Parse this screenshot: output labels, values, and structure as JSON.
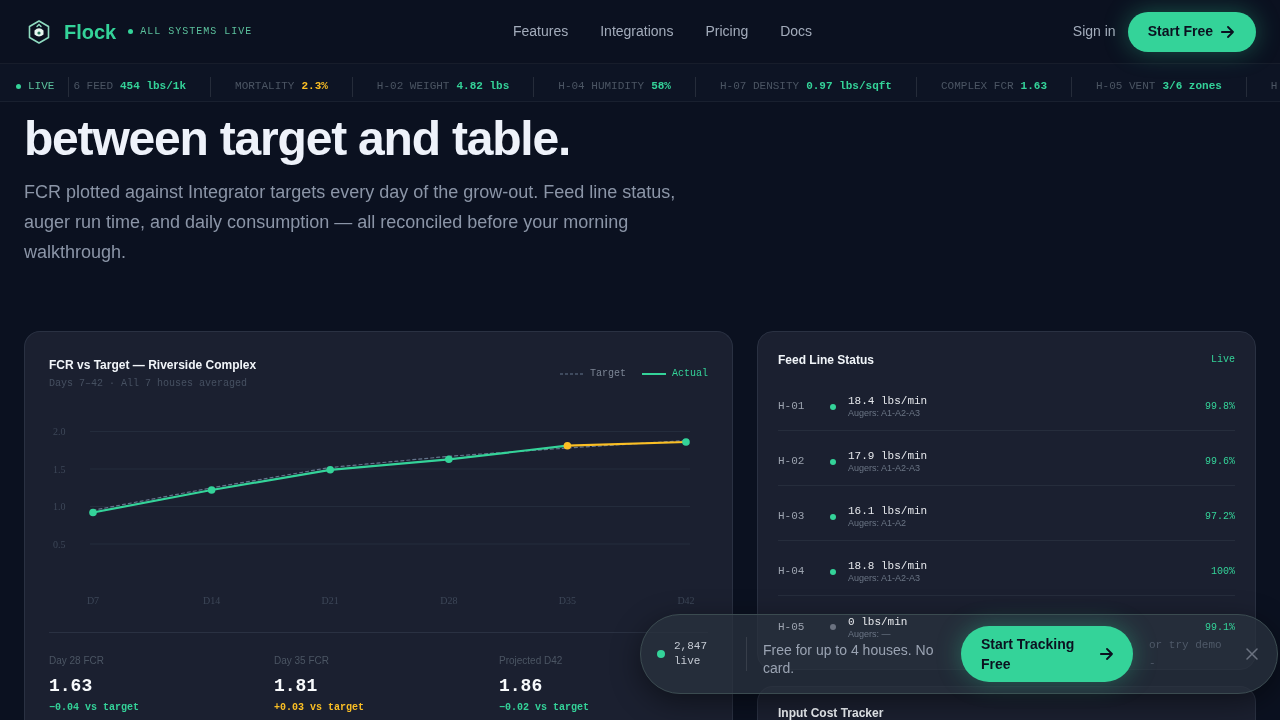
{
  "header": {
    "brand": "Flock",
    "status": "ALL SYSTEMS LIVE",
    "nav": [
      {
        "label": "Features"
      },
      {
        "label": "Integrations"
      },
      {
        "label": "Pricing"
      },
      {
        "label": "Docs"
      }
    ],
    "sign_in": "Sign in",
    "cta": "Start Free"
  },
  "ticker": {
    "label": "LIVE",
    "items": [
      {
        "label": "6 FEED",
        "value": "454 lbs/1k",
        "color": "#34d399"
      },
      {
        "label": "MORTALITY",
        "value": "2.3%",
        "color": "#fbbf24"
      },
      {
        "label": "H-02 WEIGHT",
        "value": "4.82 lbs",
        "color": "#34d399"
      },
      {
        "label": "H-04 HUMIDITY",
        "value": "58%",
        "color": "#34d399"
      },
      {
        "label": "H-07 DENSITY",
        "value": "0.97 lbs/sqft",
        "color": "#34d399"
      },
      {
        "label": "COMPLEX FCR",
        "value": "1.63",
        "color": "#34d399"
      },
      {
        "label": "H-05 VENT",
        "value": "3/6 zones",
        "color": "#34d399"
      },
      {
        "label": "H"
      }
    ]
  },
  "hero": {
    "headline": "between target and table.",
    "subtitle": "FCR plotted against Integrator targets every day of the grow-out. Feed line status, auger run time, and daily consumption — all reconciled before your morning walkthrough."
  },
  "fcr_card": {
    "chart_data": [
      {
        "type": "line",
        "title": "FCR vs Target — Riverside Complex",
        "subtitle": "Days 7–42 · All 7 houses averaged",
        "legend": "top-right",
        "grid": true,
        "categories": [
          "D7",
          "D14",
          "D21",
          "D28",
          "D35",
          "D42"
        ],
        "ylim": [
          0.5,
          2
        ],
        "yticks": [
          {
            "value": 0.5,
            "label": "0.5"
          },
          {
            "value": 1,
            "label": "1.0"
          },
          {
            "value": 1.5,
            "label": "1.5"
          },
          {
            "value": 2,
            "label": "2.0"
          }
        ],
        "series": [
          {
            "name": "Target",
            "color": "#64748b",
            "line_style": "dashed",
            "marker": "none",
            "values": [
              0.95,
              1.25,
              1.52,
              1.67,
              1.78,
              1.88
            ]
          },
          {
            "name": "Actual",
            "color": "#34d399",
            "marker": "circle",
            "values": [
              0.92,
              1.22,
              1.49,
              1.63,
              1.81,
              null
            ],
            "colors": [
              "#34d399",
              "#34d399",
              "#34d399",
              "#34d399",
              "#fbbf24",
              null
            ]
          },
          {
            "color": "#fbbf24",
            "marker": "circle",
            "values": [
              null,
              null,
              null,
              null,
              1.81,
              1.86
            ],
            "colors": [
              null,
              null,
              null,
              null,
              null,
              "#34d399"
            ]
          }
        ]
      }
    ],
    "stats": [
      {
        "label": "Day 28 FCR",
        "value": "1.63",
        "delta": "−0.04 vs target",
        "color": "#34d399"
      },
      {
        "label": "Day 35 FCR",
        "value": "1.81",
        "delta": "+0.03 vs target",
        "color": "#fbbf24"
      },
      {
        "label": "Projected D42",
        "value": "1.86",
        "delta": "−0.02 vs target",
        "color": "#34d399"
      }
    ]
  },
  "feed_status": {
    "title": "Feed Line Status",
    "badge": "Live",
    "rows": [
      {
        "house": "H-01",
        "flow": "18.4 lbs/min",
        "augers": "Augers: A1-A2-A3",
        "uptime": "99.8%",
        "color": "#34d399"
      },
      {
        "house": "H-02",
        "flow": "17.9 lbs/min",
        "augers": "Augers: A1-A2-A3",
        "uptime": "99.6%",
        "color": "#34d399"
      },
      {
        "house": "H-03",
        "flow": "16.1 lbs/min",
        "augers": "Augers: A1-A2",
        "uptime": "97.2%",
        "color": "#34d399"
      },
      {
        "house": "H-04",
        "flow": "18.8 lbs/min",
        "augers": "Augers: A1-A2-A3",
        "uptime": "100%",
        "color": "#34d399"
      },
      {
        "house": "H-05",
        "flow": "0 lbs/min",
        "augers": "Augers: —",
        "uptime": "99.1%",
        "color": "#6b7280"
      }
    ]
  },
  "input_cost": {
    "title": "Input Cost Tracker"
  },
  "signup_bar": {
    "live": "2,847 live",
    "message": "Free for up to 4 houses. No card.",
    "cta": "Start Tracking Free",
    "secondary": "or try demo -"
  }
}
